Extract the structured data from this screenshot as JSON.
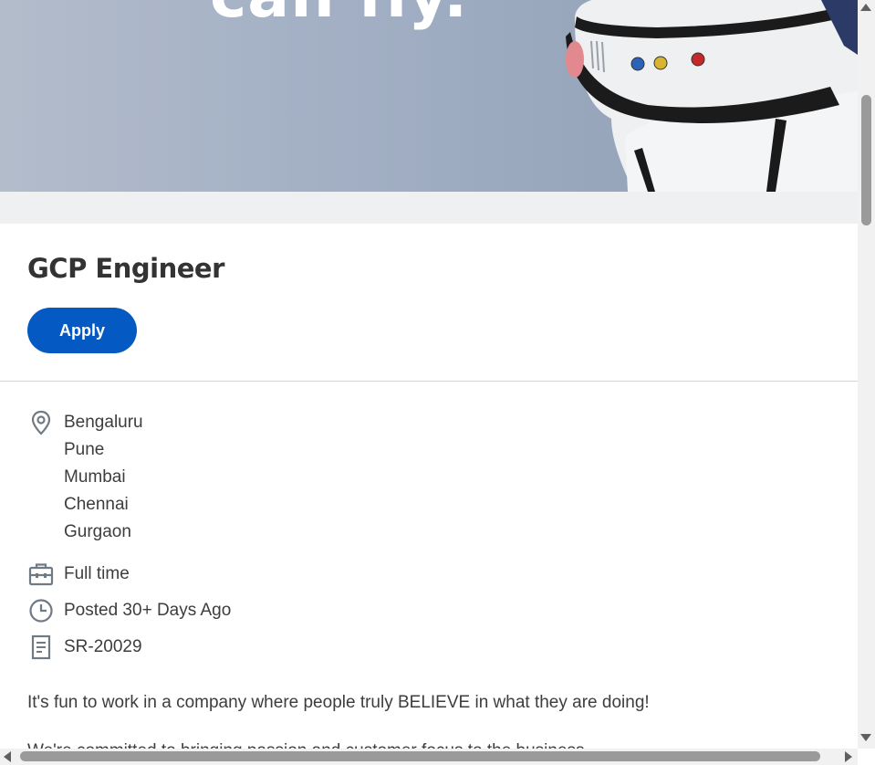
{
  "hero": {
    "banner_text": "can fly."
  },
  "job": {
    "title": "GCP Engineer",
    "apply_label": "Apply",
    "locations": [
      "Bengaluru",
      "Pune",
      "Mumbai",
      "Chennai",
      "Gurgaon"
    ],
    "employment_type": "Full time",
    "posted": "Posted 30+ Days Ago",
    "requisition_id": "SR-20029",
    "description_line_1": "It's fun to work in a company where people truly BELIEVE in what they are doing!",
    "description_line_2": "We're committed to bringing passion and customer focus to the business."
  },
  "icons": {
    "location": "location-pin-icon",
    "type": "briefcase-icon",
    "posted": "clock-icon",
    "id": "document-icon"
  },
  "colors": {
    "accent": "#0559c2",
    "icon": "#707a85",
    "text": "#333333"
  }
}
